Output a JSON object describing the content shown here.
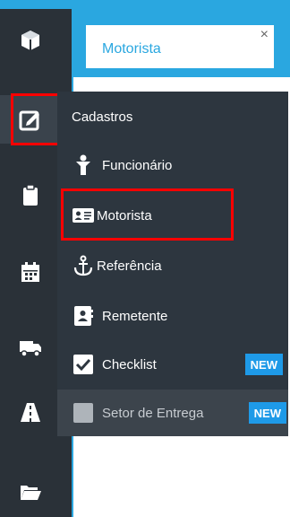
{
  "tab": {
    "label": "Motorista",
    "close": "×"
  },
  "menu": {
    "header": "Cadastros",
    "items": [
      {
        "label": "Funcionário",
        "icon": "person-icon"
      },
      {
        "label": "Motorista",
        "icon": "id-card-icon"
      },
      {
        "label": "Referência",
        "icon": "anchor-icon"
      },
      {
        "label": "Remetente",
        "icon": "contact-card-icon"
      },
      {
        "label": "Checklist",
        "icon": "checkbox-icon",
        "badge": "NEW"
      },
      {
        "label": "Setor de Entrega",
        "icon": "square-icon",
        "badge": "NEW"
      }
    ]
  },
  "sidebar": {
    "icons": [
      "cube-icon",
      "edit-icon",
      "clipboard-icon",
      "calendar-icon",
      "truck-icon",
      "road-icon",
      "folder-open-icon"
    ]
  },
  "colors": {
    "accent": "#2aa7e0",
    "sidebar_bg": "#2a3138",
    "menu_bg": "#2d363f",
    "badge": "#1e9ae8",
    "highlight": "#ff0000"
  }
}
